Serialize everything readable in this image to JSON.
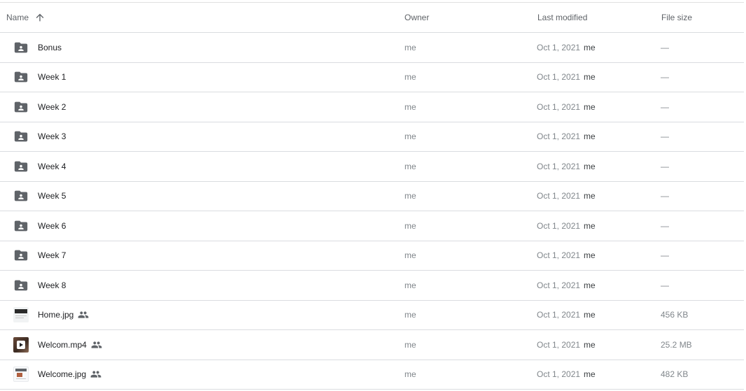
{
  "header": {
    "name": "Name",
    "sort_icon": "arrow-up-icon",
    "owner": "Owner",
    "last_modified": "Last modified",
    "file_size": "File size"
  },
  "rows": [
    {
      "type": "shared-folder",
      "icon": "shared-folder-icon",
      "name": "Bonus",
      "owner": "me",
      "modified_date": "Oct 1, 2021",
      "modified_by": "me",
      "size": "—",
      "shared": false
    },
    {
      "type": "shared-folder",
      "icon": "shared-folder-icon",
      "name": "Week 1",
      "owner": "me",
      "modified_date": "Oct 1, 2021",
      "modified_by": "me",
      "size": "—",
      "shared": false
    },
    {
      "type": "shared-folder",
      "icon": "shared-folder-icon",
      "name": "Week 2",
      "owner": "me",
      "modified_date": "Oct 1, 2021",
      "modified_by": "me",
      "size": "—",
      "shared": false
    },
    {
      "type": "shared-folder",
      "icon": "shared-folder-icon",
      "name": "Week 3",
      "owner": "me",
      "modified_date": "Oct 1, 2021",
      "modified_by": "me",
      "size": "—",
      "shared": false
    },
    {
      "type": "shared-folder",
      "icon": "shared-folder-icon",
      "name": "Week 4",
      "owner": "me",
      "modified_date": "Oct 1, 2021",
      "modified_by": "me",
      "size": "—",
      "shared": false
    },
    {
      "type": "shared-folder",
      "icon": "shared-folder-icon",
      "name": "Week 5",
      "owner": "me",
      "modified_date": "Oct 1, 2021",
      "modified_by": "me",
      "size": "—",
      "shared": false
    },
    {
      "type": "shared-folder",
      "icon": "shared-folder-icon",
      "name": "Week 6",
      "owner": "me",
      "modified_date": "Oct 1, 2021",
      "modified_by": "me",
      "size": "—",
      "shared": false
    },
    {
      "type": "shared-folder",
      "icon": "shared-folder-icon",
      "name": "Week 7",
      "owner": "me",
      "modified_date": "Oct 1, 2021",
      "modified_by": "me",
      "size": "—",
      "shared": false
    },
    {
      "type": "shared-folder",
      "icon": "shared-folder-icon",
      "name": "Week 8",
      "owner": "me",
      "modified_date": "Oct 1, 2021",
      "modified_by": "me",
      "size": "—",
      "shared": false
    },
    {
      "type": "image",
      "icon": "image-thumbnail-icon",
      "name": "Home.jpg",
      "owner": "me",
      "modified_date": "Oct 1, 2021",
      "modified_by": "me",
      "size": "456 KB",
      "shared": true
    },
    {
      "type": "video",
      "icon": "video-thumbnail-icon",
      "name": "Welcom.mp4",
      "owner": "me",
      "modified_date": "Oct 1, 2021",
      "modified_by": "me",
      "size": "25.2 MB",
      "shared": true
    },
    {
      "type": "image",
      "icon": "image-thumbnail-icon",
      "name": "Welcome.jpg",
      "owner": "me",
      "modified_date": "Oct 1, 2021",
      "modified_by": "me",
      "size": "482 KB",
      "shared": true
    }
  ],
  "colors": {
    "divider": "#dadce0",
    "text_primary": "#202124",
    "text_muted": "#80868b",
    "icon": "#5f6368"
  }
}
